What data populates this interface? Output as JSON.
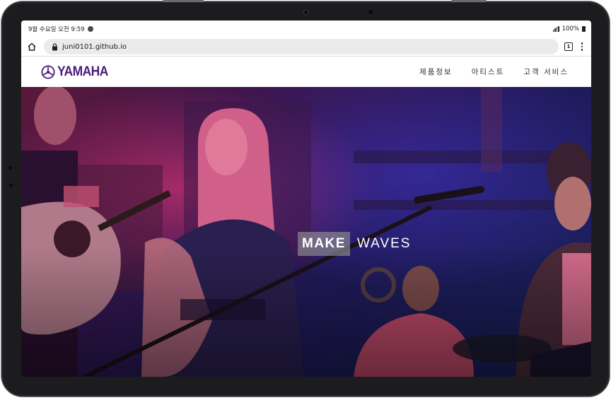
{
  "status_bar": {
    "time": "9월 수요일 오전 9:59",
    "battery": "100%"
  },
  "browser": {
    "url": "juni0101.github.io",
    "tab_count": "1"
  },
  "site": {
    "brand": "YAMAHA",
    "brand_color": "#4b1c7a",
    "nav": [
      {
        "label": "제품정보"
      },
      {
        "label": "아티스트"
      },
      {
        "label": "고객 서비스"
      }
    ]
  },
  "hero": {
    "highlight_word": "MAKE",
    "word": "WAVES"
  },
  "icons": {
    "home": "home-icon",
    "lock": "lock-icon",
    "tabs": "tabs-icon",
    "menu": "more-vert-icon",
    "logo": "tuning-fork-emblem-icon"
  }
}
